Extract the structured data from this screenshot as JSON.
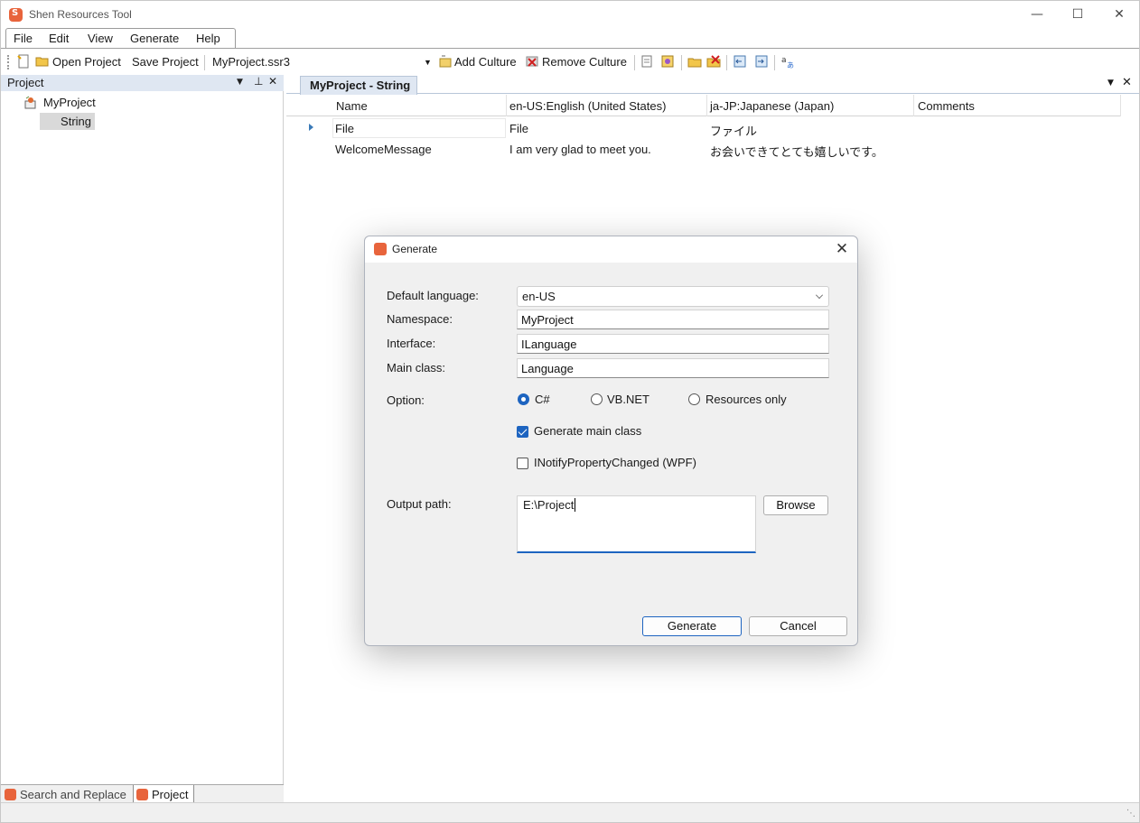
{
  "window": {
    "title": "Shen Resources Tool"
  },
  "menu": {
    "items": [
      "File",
      "Edit",
      "View",
      "Generate",
      "Help"
    ]
  },
  "toolbar": {
    "open_project": "Open Project",
    "save_project": "Save Project",
    "project_file": "MyProject.ssr3",
    "add_culture": "Add Culture",
    "remove_culture": "Remove Culture"
  },
  "project_panel": {
    "title": "Project",
    "tree": {
      "root": "MyProject",
      "child": "String"
    },
    "bottom_tabs": [
      "Search and Replace",
      "Project"
    ]
  },
  "document": {
    "tab": "MyProject - String",
    "columns": [
      "Name",
      "en-US:English (United States)",
      "ja-JP:Japanese (Japan)",
      "Comments"
    ],
    "rows": [
      [
        "File",
        "File",
        "ファイル",
        ""
      ],
      [
        "WelcomeMessage",
        "I am very glad to meet you.",
        "お会いできてとても嬉しいです。",
        ""
      ]
    ]
  },
  "dialog": {
    "title": "Generate",
    "default_language_label": "Default language:",
    "default_language_value": "en-US",
    "namespace_label": "Namespace:",
    "namespace_value": "MyProject",
    "interface_label": "Interface:",
    "interface_value": "ILanguage",
    "main_class_label": "Main class:",
    "main_class_value": "Language",
    "option_label": "Option:",
    "options": [
      "C#",
      "VB.NET",
      "Resources only"
    ],
    "selected_option": "C#",
    "generate_main_class": "Generate main class",
    "generate_main_class_checked": true,
    "inotify": "INotifyPropertyChanged (WPF)",
    "inotify_checked": false,
    "output_path_label": "Output path:",
    "output_path_value": "E:\\Project",
    "browse": "Browse",
    "generate": "Generate",
    "cancel": "Cancel"
  }
}
